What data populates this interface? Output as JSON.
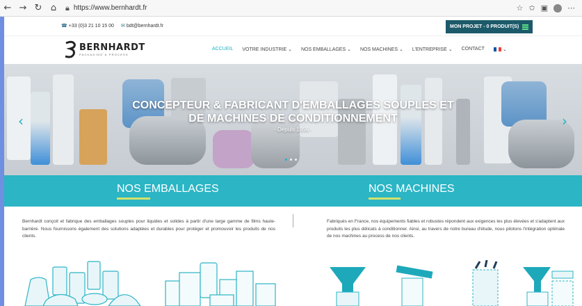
{
  "browser": {
    "url": "https://www.bernhardt.fr",
    "icons": [
      "back-icon",
      "forward-icon",
      "reload-icon",
      "home-icon",
      "lock-icon",
      "star-icon",
      "favorites-icon",
      "collections-icon",
      "profile-avatar",
      "more-icon"
    ]
  },
  "topbar": {
    "phone": "+33 (0)3 21 10 15 00",
    "email": "bdt@bernhardt.fr",
    "project_button": "MON PROJET - 0 PRODUIT(S)"
  },
  "logo": {
    "name": "BERNHARDT",
    "tagline": "PACKAGING & PROCESS"
  },
  "menu": [
    {
      "label": "ACCUEIL",
      "active": true
    },
    {
      "label": "VOTRE INDUSTRIE ⌄",
      "active": false
    },
    {
      "label": "NOS EMBALLAGES ⌄",
      "active": false
    },
    {
      "label": "NOS MACHINES ⌄",
      "active": false
    },
    {
      "label": "L'ENTREPRISE ⌄",
      "active": false
    },
    {
      "label": "CONTACT",
      "active": false
    }
  ],
  "hero": {
    "title_line1": "CONCEPTEUR & FABRICANT D'EMBALLAGES SOUPLES ET",
    "title_line2": "DE MACHINES DE CONDITIONNEMENT",
    "subtitle": "- Depuis 1956 -"
  },
  "sections": {
    "emballages": {
      "title": "NOS EMBALLAGES",
      "text": "Bernhardt conçoit et fabrique des emballages souples pour liquides et solides à partir d'une large gamme de films haute-barrière. Nous fournissons également des solutions adaptées et durables pour protéger et promouvoir les produits de nos clients."
    },
    "machines": {
      "title": "NOS MACHINES",
      "text": "Fabriqués en France, nos équipements fiables et robustes répondent aux exigences les plus élevées et s'adaptent aux produits les plus délicats à conditionner. Ainsi, au travers de notre bureau d'étude, nous pilotons l'intégration optimale de nos machines au process de nos clients."
    }
  },
  "colors": {
    "accent": "#1bb3c8",
    "band": "#2bb5c5",
    "underline": "#d5e26a",
    "project_button": "#1c5a6a",
    "flag": [
      "#0055a4",
      "#ffffff",
      "#ef4135"
    ]
  }
}
